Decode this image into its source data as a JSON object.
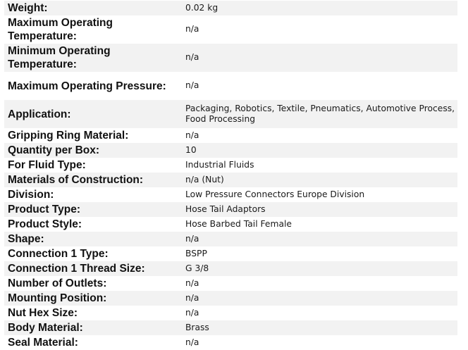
{
  "specs": [
    {
      "label": "Weight:",
      "value": "0.02 kg"
    },
    {
      "label": "Maximum Operating Temperature:",
      "value": "n/a"
    },
    {
      "label": "Minimum Operating Temperature:",
      "value": "n/a"
    },
    {
      "label": "Maximum Operating Pressure:",
      "value": "n/a"
    },
    {
      "label": "Application:",
      "value": "Packaging, Robotics, Textile, Pneumatics, Automotive Process, Food Processing"
    },
    {
      "label": "Gripping Ring Material:",
      "value": "n/a"
    },
    {
      "label": "Quantity per Box:",
      "value": "10"
    },
    {
      "label": "For Fluid Type:",
      "value": "Industrial Fluids"
    },
    {
      "label": "Materials of Construction:",
      "value": "n/a (Nut)"
    },
    {
      "label": "Division:",
      "value": "Low Pressure Connectors Europe Division"
    },
    {
      "label": "Product Type:",
      "value": "Hose Tail Adaptors"
    },
    {
      "label": "Product Style:",
      "value": "Hose Barbed Tail Female"
    },
    {
      "label": "Shape:",
      "value": "n/a"
    },
    {
      "label": "Connection 1 Type:",
      "value": "BSPP"
    },
    {
      "label": "Connection 1 Thread Size:",
      "value": "G 3/8"
    },
    {
      "label": "Number of Outlets:",
      "value": "n/a"
    },
    {
      "label": "Mounting Position:",
      "value": "n/a"
    },
    {
      "label": "Nut Hex Size:",
      "value": "n/a"
    },
    {
      "label": "Body Material:",
      "value": "Brass"
    },
    {
      "label": "Seal Material:",
      "value": "n/a"
    }
  ]
}
